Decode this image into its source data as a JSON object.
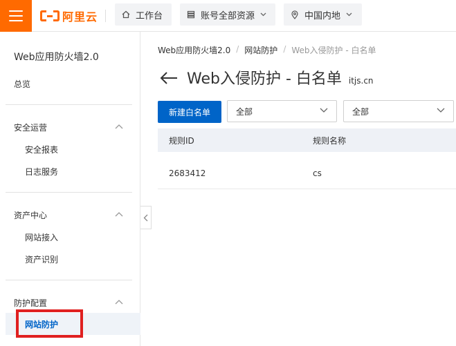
{
  "topbar": {
    "logo_text": "阿里云",
    "workbench_label": "工作台",
    "resources_label": "账号全部资源",
    "region_label": "中国内地"
  },
  "sidebar": {
    "product_title": "Web应用防火墙2.0",
    "overview": "总览",
    "groups": [
      {
        "label": "安全运营",
        "items": [
          "安全报表",
          "日志服务"
        ]
      },
      {
        "label": "资产中心",
        "items": [
          "网站接入",
          "资产识别"
        ]
      },
      {
        "label": "防护配置",
        "items": [
          "网站防护"
        ]
      }
    ],
    "active_item": "网站防护"
  },
  "breadcrumb": [
    "Web应用防火墙2.0",
    "网站防护",
    "Web入侵防护 - 白名单"
  ],
  "page": {
    "title": "Web入侵防护 - 白名单",
    "domain": "itjs.cn",
    "new_button": "新建白名单",
    "filter1": "全部",
    "filter2": "全部"
  },
  "table": {
    "columns": [
      "规则ID",
      "规则名称"
    ],
    "rows": [
      {
        "id": "2683412",
        "name": "cs"
      }
    ]
  },
  "colors": {
    "brand": "#ff6a00",
    "primary": "#0064c8",
    "highlight": "#e02020"
  }
}
